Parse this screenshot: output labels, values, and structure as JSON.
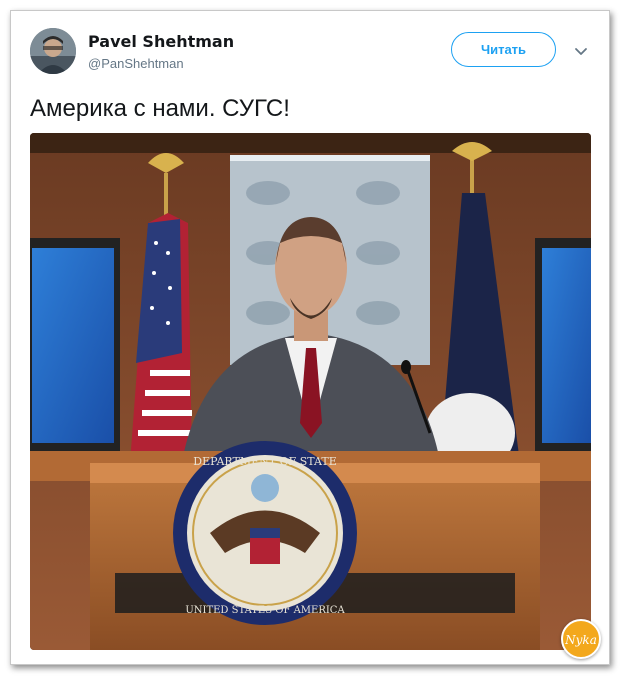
{
  "tweet": {
    "author_name": "Pavel Shehtman",
    "author_handle": "@PanShehtman",
    "follow_label": "Читать",
    "text": "Америка с нами. СУГС!"
  },
  "photo": {
    "description_icon": "press-briefing-photo",
    "seal_text_top": "DEPARTMENT OF STATE",
    "seal_text_bottom": "UNITED STATES OF AMERICA"
  },
  "watermark": {
    "label": "Nyka"
  },
  "colors": {
    "accent": "#1da1f2",
    "text": "#14171a",
    "muted": "#657786"
  }
}
